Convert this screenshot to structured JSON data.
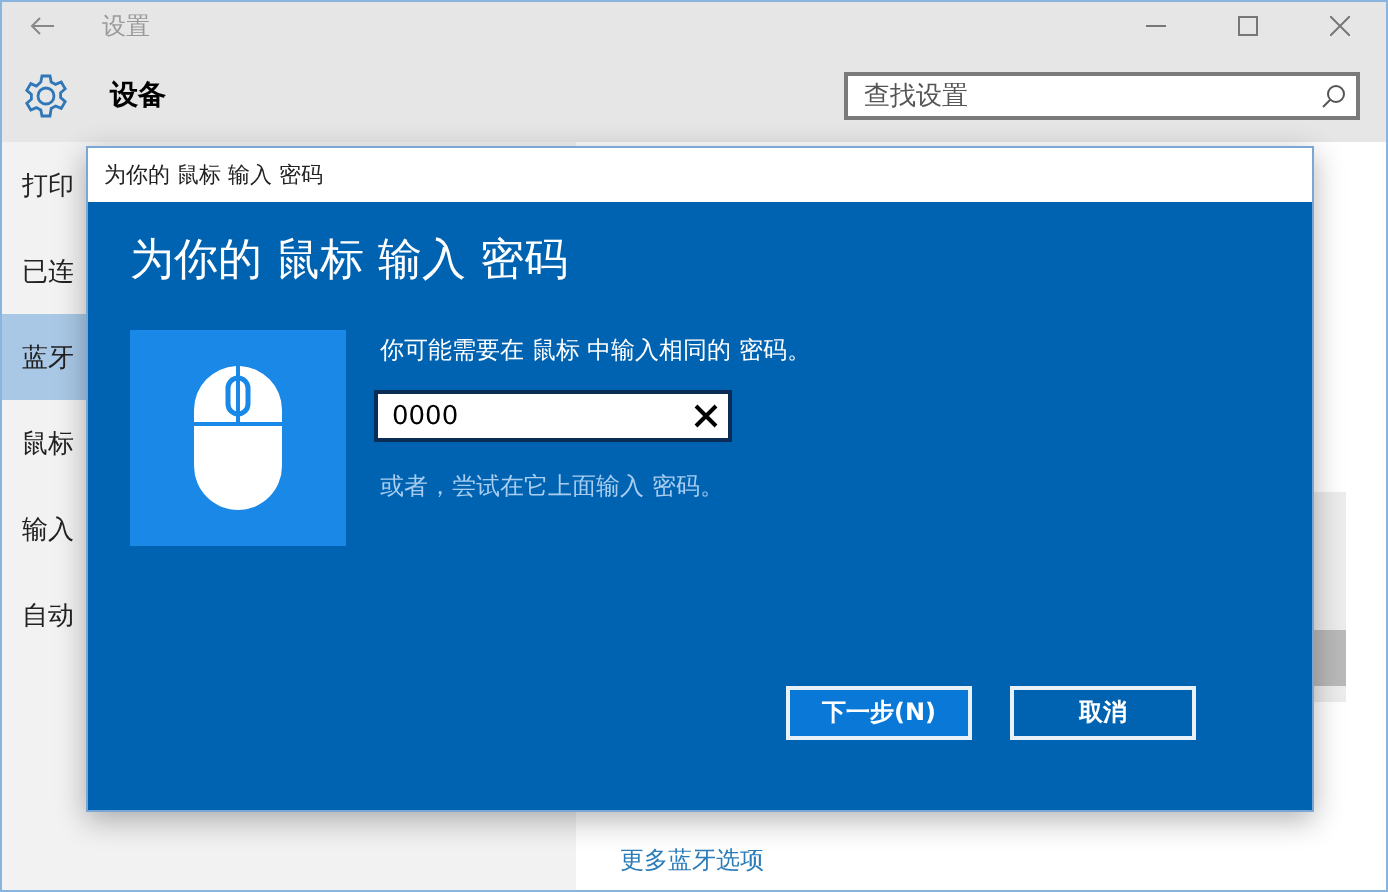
{
  "window": {
    "title": "设置",
    "page_title": "设备",
    "search": {
      "placeholder": "查找设置"
    }
  },
  "sidebar": {
    "items": [
      {
        "label": "打印",
        "selected": false
      },
      {
        "label": "已连",
        "selected": false
      },
      {
        "label": "蓝牙",
        "selected": true
      },
      {
        "label": "鼠标",
        "selected": false
      },
      {
        "label": "输入",
        "selected": false
      },
      {
        "label": "自动",
        "selected": false
      }
    ]
  },
  "content": {
    "link": "更多蓝牙选项"
  },
  "dialog": {
    "title": "为你的 鼠标 输入 密码",
    "heading": "为你的 鼠标 输入 密码",
    "instruction": "你可能需要在 鼠标 中输入相同的 密码。",
    "pin": {
      "value": "0000"
    },
    "hint": "或者，尝试在它上面输入 密码。",
    "buttons": [
      {
        "label": "下一步(N)",
        "kind": "primary"
      },
      {
        "label": "取消",
        "kind": "secondary"
      }
    ]
  }
}
